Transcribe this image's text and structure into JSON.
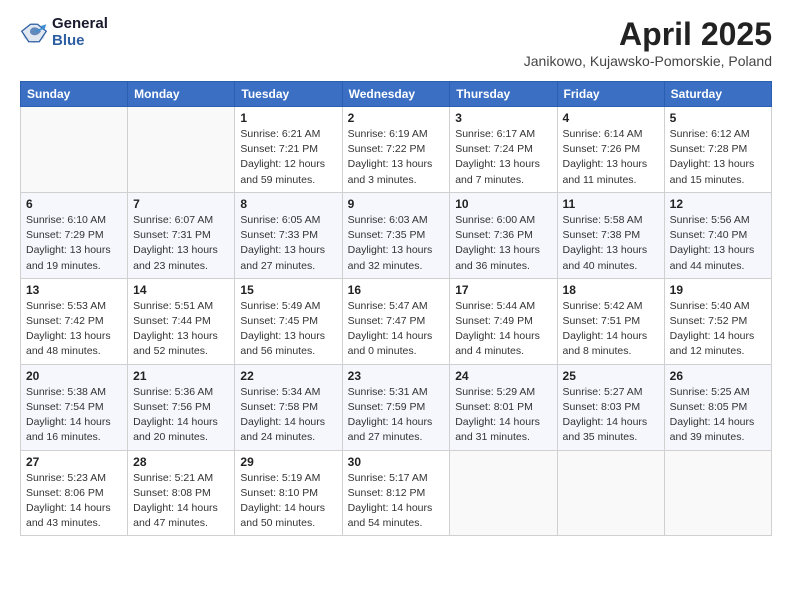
{
  "header": {
    "logo_general": "General",
    "logo_blue": "Blue",
    "month_title": "April 2025",
    "location": "Janikowo, Kujawsko-Pomorskie, Poland"
  },
  "days_of_week": [
    "Sunday",
    "Monday",
    "Tuesday",
    "Wednesday",
    "Thursday",
    "Friday",
    "Saturday"
  ],
  "weeks": [
    [
      {
        "day": "",
        "info": ""
      },
      {
        "day": "",
        "info": ""
      },
      {
        "day": "1",
        "info": "Sunrise: 6:21 AM\nSunset: 7:21 PM\nDaylight: 12 hours\nand 59 minutes."
      },
      {
        "day": "2",
        "info": "Sunrise: 6:19 AM\nSunset: 7:22 PM\nDaylight: 13 hours\nand 3 minutes."
      },
      {
        "day": "3",
        "info": "Sunrise: 6:17 AM\nSunset: 7:24 PM\nDaylight: 13 hours\nand 7 minutes."
      },
      {
        "day": "4",
        "info": "Sunrise: 6:14 AM\nSunset: 7:26 PM\nDaylight: 13 hours\nand 11 minutes."
      },
      {
        "day": "5",
        "info": "Sunrise: 6:12 AM\nSunset: 7:28 PM\nDaylight: 13 hours\nand 15 minutes."
      }
    ],
    [
      {
        "day": "6",
        "info": "Sunrise: 6:10 AM\nSunset: 7:29 PM\nDaylight: 13 hours\nand 19 minutes."
      },
      {
        "day": "7",
        "info": "Sunrise: 6:07 AM\nSunset: 7:31 PM\nDaylight: 13 hours\nand 23 minutes."
      },
      {
        "day": "8",
        "info": "Sunrise: 6:05 AM\nSunset: 7:33 PM\nDaylight: 13 hours\nand 27 minutes."
      },
      {
        "day": "9",
        "info": "Sunrise: 6:03 AM\nSunset: 7:35 PM\nDaylight: 13 hours\nand 32 minutes."
      },
      {
        "day": "10",
        "info": "Sunrise: 6:00 AM\nSunset: 7:36 PM\nDaylight: 13 hours\nand 36 minutes."
      },
      {
        "day": "11",
        "info": "Sunrise: 5:58 AM\nSunset: 7:38 PM\nDaylight: 13 hours\nand 40 minutes."
      },
      {
        "day": "12",
        "info": "Sunrise: 5:56 AM\nSunset: 7:40 PM\nDaylight: 13 hours\nand 44 minutes."
      }
    ],
    [
      {
        "day": "13",
        "info": "Sunrise: 5:53 AM\nSunset: 7:42 PM\nDaylight: 13 hours\nand 48 minutes."
      },
      {
        "day": "14",
        "info": "Sunrise: 5:51 AM\nSunset: 7:44 PM\nDaylight: 13 hours\nand 52 minutes."
      },
      {
        "day": "15",
        "info": "Sunrise: 5:49 AM\nSunset: 7:45 PM\nDaylight: 13 hours\nand 56 minutes."
      },
      {
        "day": "16",
        "info": "Sunrise: 5:47 AM\nSunset: 7:47 PM\nDaylight: 14 hours\nand 0 minutes."
      },
      {
        "day": "17",
        "info": "Sunrise: 5:44 AM\nSunset: 7:49 PM\nDaylight: 14 hours\nand 4 minutes."
      },
      {
        "day": "18",
        "info": "Sunrise: 5:42 AM\nSunset: 7:51 PM\nDaylight: 14 hours\nand 8 minutes."
      },
      {
        "day": "19",
        "info": "Sunrise: 5:40 AM\nSunset: 7:52 PM\nDaylight: 14 hours\nand 12 minutes."
      }
    ],
    [
      {
        "day": "20",
        "info": "Sunrise: 5:38 AM\nSunset: 7:54 PM\nDaylight: 14 hours\nand 16 minutes."
      },
      {
        "day": "21",
        "info": "Sunrise: 5:36 AM\nSunset: 7:56 PM\nDaylight: 14 hours\nand 20 minutes."
      },
      {
        "day": "22",
        "info": "Sunrise: 5:34 AM\nSunset: 7:58 PM\nDaylight: 14 hours\nand 24 minutes."
      },
      {
        "day": "23",
        "info": "Sunrise: 5:31 AM\nSunset: 7:59 PM\nDaylight: 14 hours\nand 27 minutes."
      },
      {
        "day": "24",
        "info": "Sunrise: 5:29 AM\nSunset: 8:01 PM\nDaylight: 14 hours\nand 31 minutes."
      },
      {
        "day": "25",
        "info": "Sunrise: 5:27 AM\nSunset: 8:03 PM\nDaylight: 14 hours\nand 35 minutes."
      },
      {
        "day": "26",
        "info": "Sunrise: 5:25 AM\nSunset: 8:05 PM\nDaylight: 14 hours\nand 39 minutes."
      }
    ],
    [
      {
        "day": "27",
        "info": "Sunrise: 5:23 AM\nSunset: 8:06 PM\nDaylight: 14 hours\nand 43 minutes."
      },
      {
        "day": "28",
        "info": "Sunrise: 5:21 AM\nSunset: 8:08 PM\nDaylight: 14 hours\nand 47 minutes."
      },
      {
        "day": "29",
        "info": "Sunrise: 5:19 AM\nSunset: 8:10 PM\nDaylight: 14 hours\nand 50 minutes."
      },
      {
        "day": "30",
        "info": "Sunrise: 5:17 AM\nSunset: 8:12 PM\nDaylight: 14 hours\nand 54 minutes."
      },
      {
        "day": "",
        "info": ""
      },
      {
        "day": "",
        "info": ""
      },
      {
        "day": "",
        "info": ""
      }
    ]
  ]
}
